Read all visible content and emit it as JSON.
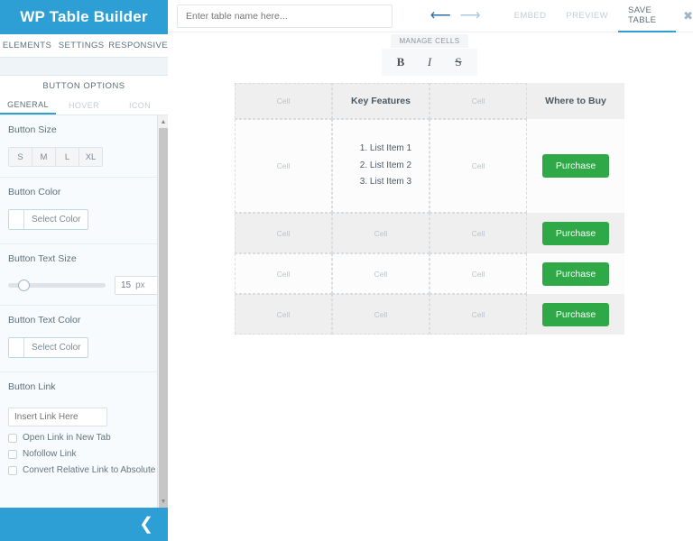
{
  "sidebar": {
    "brand": "WP Table Builder",
    "nav": [
      {
        "label": "ELEMENTS"
      },
      {
        "label": "SETTINGS"
      },
      {
        "label": "RESPONSIVE"
      }
    ],
    "panel_title": "BUTTON OPTIONS",
    "subtabs": [
      {
        "label": "GENERAL",
        "active": true
      },
      {
        "label": "HOVER",
        "active": false
      },
      {
        "label": "ICON",
        "active": false
      }
    ],
    "button_size": {
      "label": "Button Size",
      "options": [
        "S",
        "M",
        "L",
        "XL"
      ]
    },
    "button_color": {
      "label": "Button Color",
      "picker_label": "Select Color"
    },
    "button_text_size": {
      "label": "Button Text Size",
      "value": "15",
      "unit": "px",
      "slider_percent": 15
    },
    "button_text_color": {
      "label": "Button Text Color",
      "picker_label": "Select Color"
    },
    "button_link": {
      "label": "Button Link",
      "placeholder": "Insert Link Here",
      "value": "",
      "checkboxes": [
        {
          "label": "Open Link in New Tab",
          "checked": false
        },
        {
          "label": "Nofollow Link",
          "checked": false
        },
        {
          "label": "Convert Relative Link to Absolute",
          "checked": false
        }
      ]
    },
    "collapse_icon": "chevron-left-icon"
  },
  "topbar": {
    "table_name_placeholder": "Enter table name here...",
    "table_name_value": "",
    "undo_icon": "undo-arrow-icon",
    "redo_icon": "redo-arrow-icon",
    "actions": [
      {
        "label": "EMBED",
        "active": false
      },
      {
        "label": "PREVIEW",
        "active": false
      },
      {
        "label": "SAVE TABLE",
        "active": true
      }
    ],
    "close_icon": "close-icon"
  },
  "manage_cells": {
    "label": "MANAGE CELLS",
    "buttons": [
      {
        "label": "B",
        "name": "bold-button"
      },
      {
        "label": "I",
        "name": "italic-button"
      },
      {
        "label": "S",
        "name": "strikethrough-button"
      }
    ]
  },
  "table": {
    "placeholder_cell": "Cell",
    "header": [
      "Cell",
      "Key Features",
      "Cell",
      "Where to Buy"
    ],
    "list_items": [
      "List Item 1",
      "List Item 2",
      "List Item 3"
    ],
    "purchase_label": "Purchase",
    "rows": [
      {
        "cells": [
          "Cell",
          "__LIST__",
          "Cell"
        ],
        "button": "Purchase"
      },
      {
        "cells": [
          "Cell",
          "Cell",
          "Cell"
        ],
        "button": "Purchase"
      },
      {
        "cells": [
          "Cell",
          "Cell",
          "Cell"
        ],
        "button": "Purchase"
      },
      {
        "cells": [
          "Cell",
          "Cell",
          "Cell"
        ],
        "button": "Purchase"
      }
    ]
  },
  "colors": {
    "brand_blue": "#2e9fd4",
    "purchase_green": "#2fa948",
    "row_stripe": "#efefef"
  }
}
